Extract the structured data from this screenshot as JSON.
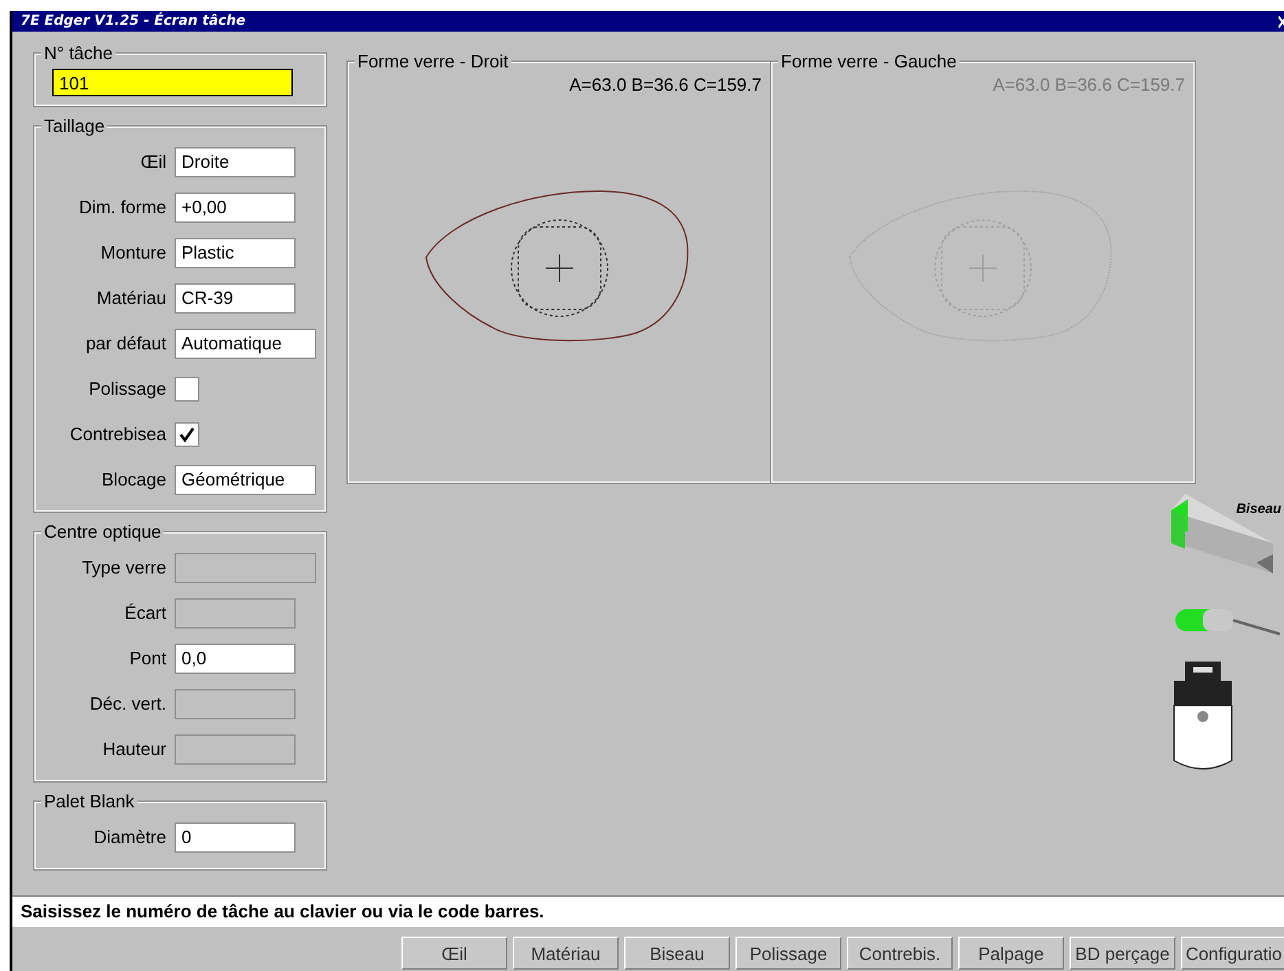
{
  "window": {
    "title": "7E Edger V1.25 - Écran tâche"
  },
  "job": {
    "legend": "N° tâche",
    "value": "101"
  },
  "groups": [
    {
      "legend": "Taillage",
      "rows": [
        {
          "label": "Œil",
          "kind": "text",
          "value": "Droite",
          "disabled": false,
          "wide": false
        },
        {
          "label": "Dim. forme",
          "kind": "text",
          "value": "+0,00",
          "disabled": false,
          "wide": false
        },
        {
          "label": "Monture",
          "kind": "text",
          "value": "Plastic",
          "disabled": false,
          "wide": false
        },
        {
          "label": "Matériau",
          "kind": "text",
          "value": "CR-39",
          "disabled": false,
          "wide": false
        },
        {
          "label": "par défaut",
          "kind": "text",
          "value": "Automatique",
          "disabled": false,
          "wide": true
        },
        {
          "label": "Polissage",
          "kind": "checkbox",
          "checked": false
        },
        {
          "label": "Contrebisea",
          "kind": "checkbox",
          "checked": true
        },
        {
          "label": "Blocage",
          "kind": "text",
          "value": "Géométrique",
          "disabled": false,
          "wide": true
        }
      ]
    },
    {
      "legend": "Centre optique",
      "rows": [
        {
          "label": "Type verre",
          "kind": "text",
          "disabled": true,
          "wide": true
        },
        {
          "label": "Écart",
          "kind": "text",
          "disabled": true,
          "wide": false
        },
        {
          "label": "Pont",
          "kind": "text",
          "value": "0,0",
          "disabled": false,
          "wide": false
        },
        {
          "label": "Déc. vert.",
          "kind": "text",
          "disabled": true,
          "wide": false
        },
        {
          "label": "Hauteur",
          "kind": "text",
          "disabled": true,
          "wide": false
        }
      ]
    },
    {
      "legend": "Palet Blank",
      "rows": [
        {
          "label": "Diamètre",
          "kind": "text",
          "value": "0",
          "disabled": false,
          "wide": false
        }
      ]
    }
  ],
  "shapes": [
    {
      "legend": "Forme verre - Droit",
      "dimensions": "A=63.0 B=36.6 C=159.7",
      "disabled": false
    },
    {
      "legend": "Forme verre - Gauche",
      "dimensions": "A=63.0 B=36.6 C=159.7",
      "disabled": true
    }
  ],
  "tools": {
    "bevel_label": "Biseau"
  },
  "status_bar": "Saisissez le numéro de tâche au clavier ou via le code barres.",
  "buttons": [
    "Œil",
    "Matériau",
    "Biseau",
    "Polissage",
    "Contrebis.",
    "Palpage",
    "BD perçage",
    "Configuratio"
  ]
}
